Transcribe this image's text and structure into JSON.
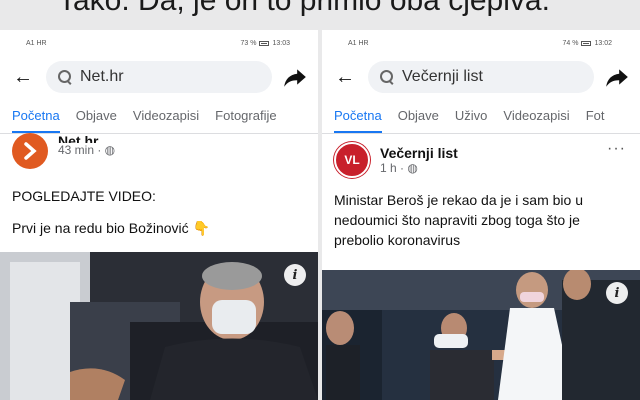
{
  "caption": "Tako. Da, je on to primio oba cjepiva.",
  "left": {
    "status": {
      "left": "A1 HR",
      "right": "73 %",
      "time": "13:03"
    },
    "search": {
      "value": "Net.hr"
    },
    "tabs": [
      "Početna",
      "Objave",
      "Videozapisi",
      "Fotografije"
    ],
    "post": {
      "page_name": "Net.hr",
      "meta": "43 min · ◍",
      "lines": [
        "POGLEDAJTE VIDEO:",
        "Prvi je na redu bio Božinović 👇"
      ]
    },
    "icons": {
      "back": "arrow-left-icon",
      "share": "share-arrow-icon",
      "info": "info-icon"
    }
  },
  "right": {
    "status": {
      "left": "A1 HR",
      "right": "74 %",
      "time": "13:02"
    },
    "search": {
      "value": "Večernji list"
    },
    "tabs": [
      "Početna",
      "Objave",
      "Uživo",
      "Videozapisi",
      "Fot"
    ],
    "post": {
      "avatar": "VL",
      "page_name": "Večernji list",
      "meta": "1 h · ◍",
      "more": "···",
      "text": "Ministar Beroš je rekao da je i sam bio u nedoumici što napraviti zbog toga što je prebolio koronavirus"
    },
    "icons": {
      "back": "arrow-left-icon",
      "share": "share-arrow-icon",
      "info": "info-icon"
    }
  },
  "colors": {
    "accent": "#1877f2",
    "netv": "#e05a21",
    "vl": "#c8202b"
  }
}
